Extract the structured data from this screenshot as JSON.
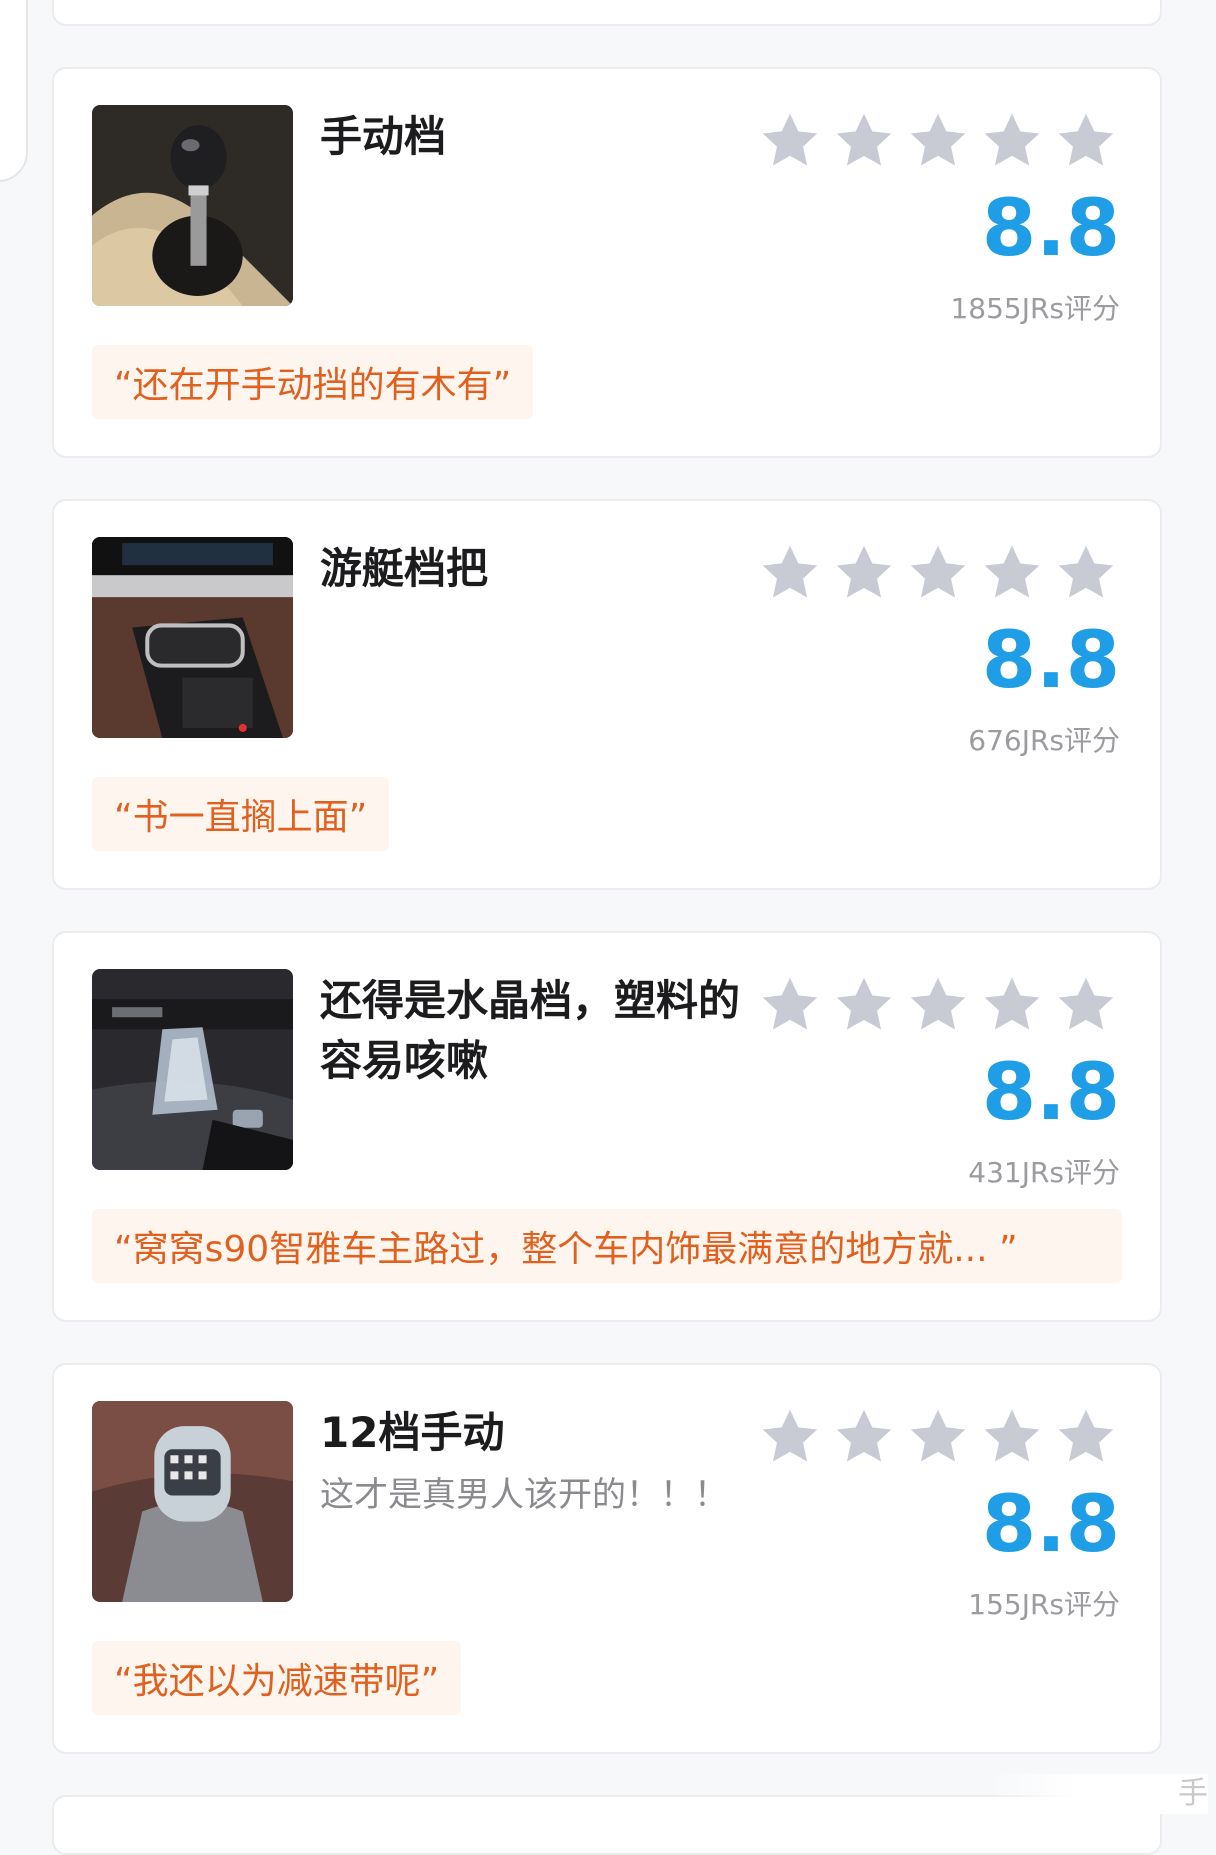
{
  "cards": [
    {
      "title": "手动档",
      "subtitle": "",
      "rating_stars": 5,
      "score": "8.8",
      "count": "1855JRs评分",
      "quote": "“还在开手动挡的有木有”",
      "thumb": "manual-gear-shifter-photo"
    },
    {
      "title": "游艇档把",
      "subtitle": "",
      "rating_stars": 5,
      "score": "8.8",
      "count": "676JRs评分",
      "quote": "“书一直搁上面”",
      "thumb": "yacht-style-shifter-photo"
    },
    {
      "title": "还得是水晶档，塑料的容易咳嗽",
      "subtitle": "",
      "rating_stars": 5,
      "score": "8.8",
      "count": "431JRs评分",
      "quote": "“窝窝s90智雅车主路过，整个车内饰最满意的地方就... ”",
      "thumb": "crystal-shifter-photo"
    },
    {
      "title": "12档手动",
      "subtitle": "这才是真男人该开的！！！",
      "rating_stars": 5,
      "score": "8.8",
      "count": "155JRs评分",
      "quote": "“我还以为减速带呢”",
      "thumb": "twelve-speed-shifter-photo"
    }
  ],
  "colors": {
    "score": "#1f9de6",
    "quote_text": "#e0611f",
    "quote_bg": "#fff5ef",
    "star": "#c8cbd4"
  },
  "corner_text": "手"
}
